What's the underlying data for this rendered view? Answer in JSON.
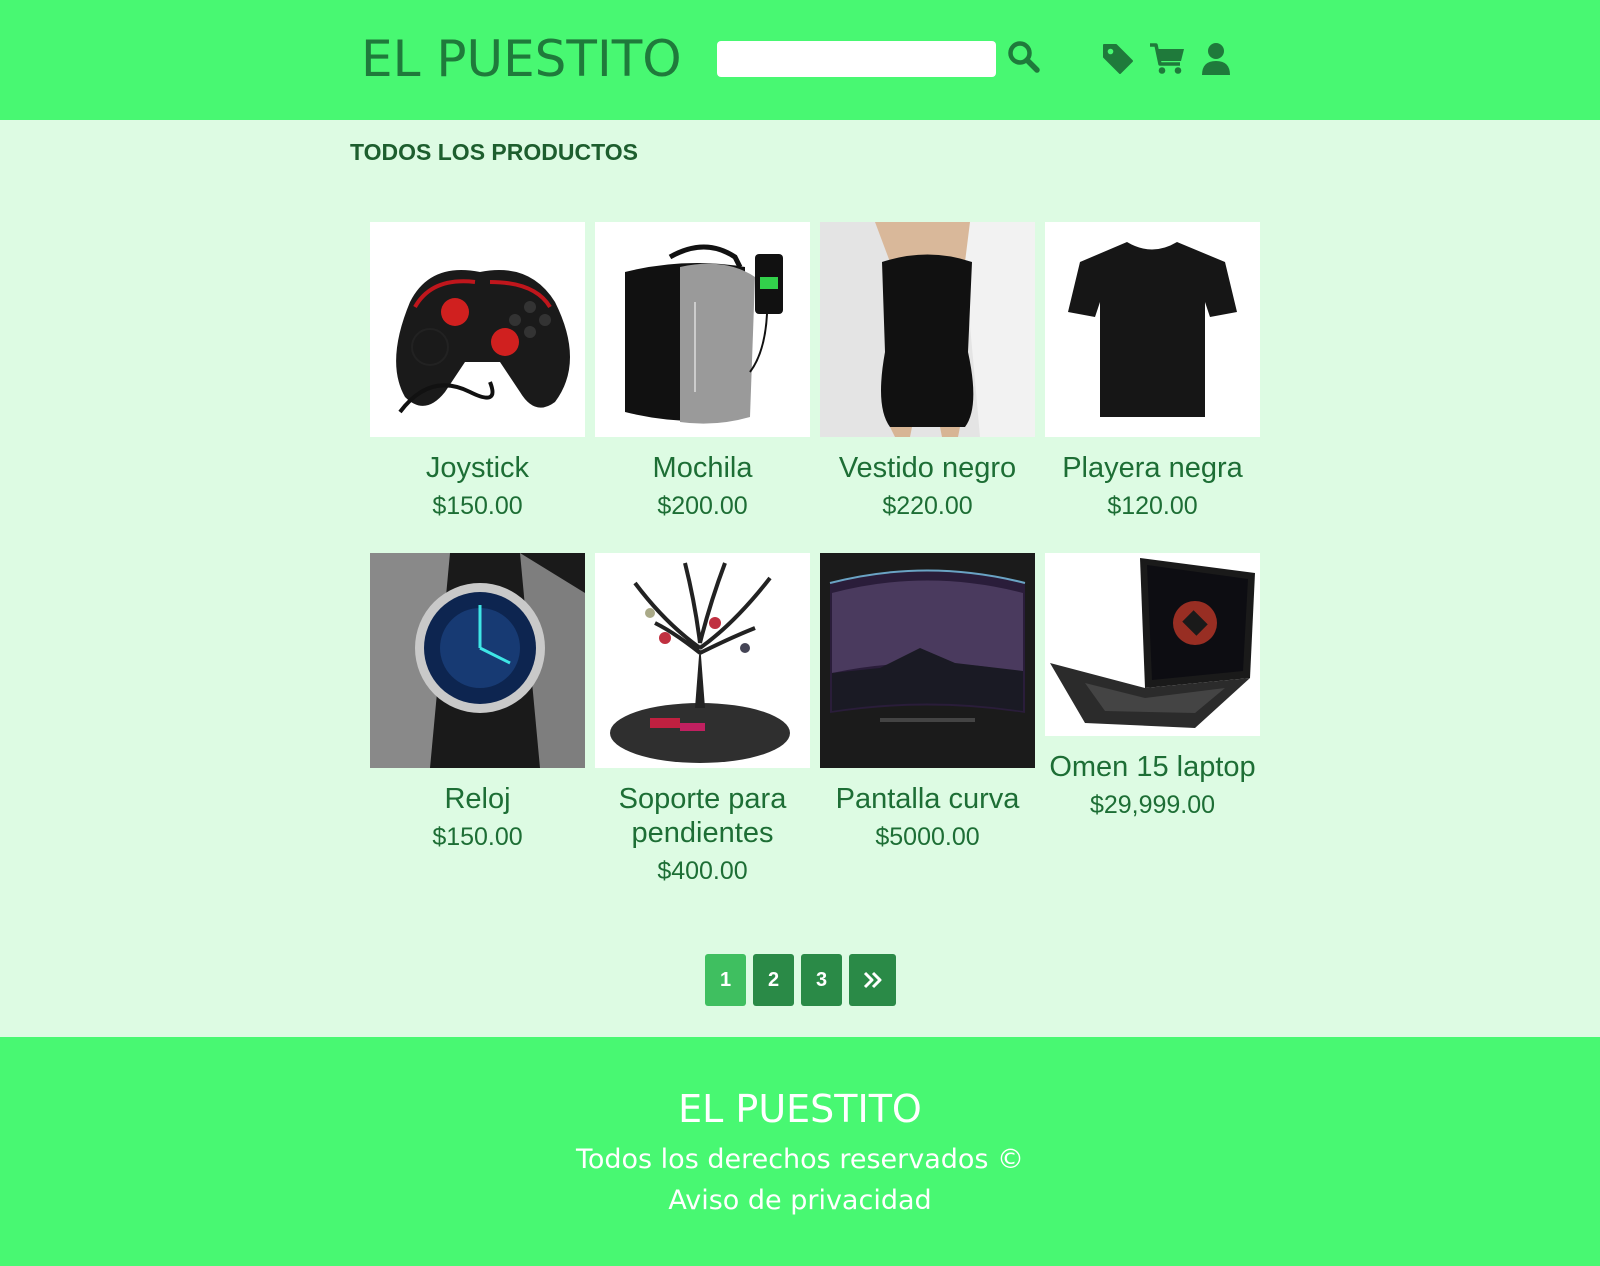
{
  "header": {
    "logo": "EL PUESTITO",
    "search_placeholder": "",
    "icons": [
      "search-icon",
      "tag-icon",
      "cart-icon",
      "user-icon"
    ],
    "background_color": "#48f872"
  },
  "main": {
    "section_title": "TODOS LOS PRODUCTOS",
    "products": [
      {
        "name": "Joystick",
        "price": "$150.00"
      },
      {
        "name": "Mochila",
        "price": "$200.00"
      },
      {
        "name": "Vestido negro",
        "price": "$220.00"
      },
      {
        "name": "Playera negra",
        "price": "$120.00"
      },
      {
        "name": "Reloj",
        "price": "$150.00"
      },
      {
        "name": "Soporte para pendientes",
        "price": "$400.00"
      },
      {
        "name": "Pantalla curva",
        "price": "$5000.00"
      },
      {
        "name": "Omen 15 laptop",
        "price": "$29,999.00"
      }
    ]
  },
  "pagination": {
    "pages": [
      "1",
      "2",
      "3"
    ],
    "current": "1",
    "next_icon": "double-chevron-right-icon"
  },
  "footer": {
    "title": "EL PUESTITO",
    "rights": "Todos los derechos reservados ©",
    "privacy": "Aviso de privacidad"
  }
}
